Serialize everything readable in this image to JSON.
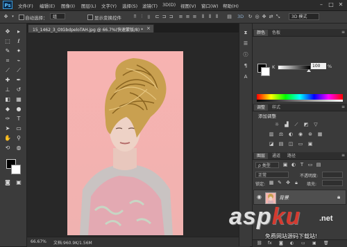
{
  "app": {
    "logo": "Ps"
  },
  "menu": [
    "文件(F)",
    "编辑(E)",
    "图像(I)",
    "图层(L)",
    "文字(Y)",
    "选择(S)",
    "滤镜(T)",
    "3D(D)",
    "视图(V)",
    "窗口(W)",
    "帮助(H)"
  ],
  "window_controls": {
    "minimize": "–",
    "restore": "□",
    "close": "✕"
  },
  "options": {
    "auto_select_label": "自动选择：",
    "auto_select_value": "组",
    "show_transform_label": "显示变换控件",
    "workspace": "3D 模式"
  },
  "document": {
    "tab_title": "15_1462_3_OtGbdpeloTAH.jpg @ 66.7%(快速蒙版/8) *",
    "close": "×",
    "zoom": "66.67%",
    "size": "文档:960.9K/1.56M"
  },
  "panels": {
    "color_tabs": [
      "颜色",
      "色板"
    ],
    "k_label": "K",
    "k_value": "100",
    "k_unit": "%",
    "adjust_tabs": [
      "调整",
      "样式"
    ],
    "adjust_title": "添加调整",
    "layers_tabs": [
      "图层",
      "通道",
      "路径"
    ],
    "kind_filter": "ρ 类型",
    "blend_mode": "正常",
    "opacity_label": "不透明度:",
    "lock_label": "锁定:",
    "fill_label": "填充:",
    "layer_name": "背景",
    "menu_glyph": "≡"
  },
  "icons": {
    "tools": [
      "move-icon",
      "marquee-icon",
      "lasso-icon",
      "quick-select-icon",
      "crop-icon",
      "eyedropper-icon",
      "healing-icon",
      "brush-icon",
      "stamp-icon",
      "history-brush-icon",
      "eraser-icon",
      "gradient-icon",
      "blur-icon",
      "dodge-icon",
      "pen-icon",
      "type-icon",
      "path-select-icon",
      "shape-icon",
      "hand-icon",
      "zoom-icon"
    ]
  },
  "watermark": {
    "text_pre": "asp",
    "text_red": "ku",
    "text_suffix": ".net",
    "subtitle": "免费网站源码下载站!"
  }
}
